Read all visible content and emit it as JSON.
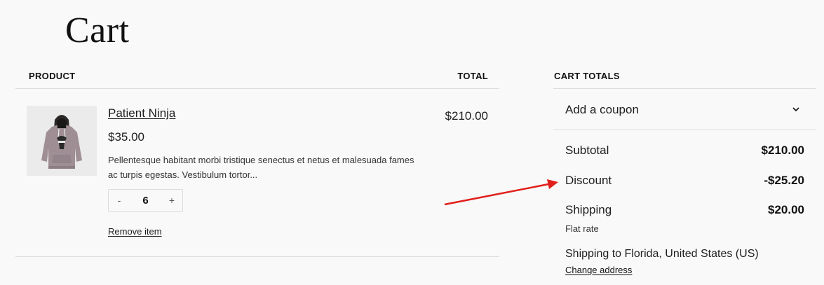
{
  "page_title": "Cart",
  "table": {
    "product_header": "PRODUCT",
    "total_header": "TOTAL"
  },
  "item": {
    "name": "Patient Ninja",
    "price": "$35.00",
    "description": "Pellentesque habitant morbi tristique senectus et netus et malesuada fames ac turpis egestas. Vestibulum tortor...",
    "quantity": "6",
    "minus_label": "-",
    "plus_label": "+",
    "remove_label": "Remove item",
    "line_total": "$210.00"
  },
  "totals": {
    "heading": "CART TOTALS",
    "coupon_label": "Add a coupon",
    "subtotal_label": "Subtotal",
    "subtotal_value": "$210.00",
    "discount_label": "Discount",
    "discount_value": "-$25.20",
    "shipping_label": "Shipping",
    "shipping_value": "$20.00",
    "shipping_method": "Flat rate",
    "shipping_destination": "Shipping to Florida, United States (US)",
    "change_address_label": "Change address"
  },
  "colors": {
    "background": "#f9f9f9",
    "annotation_arrow": "#e0201c",
    "hoodie": "#9f8f95"
  },
  "icons": {
    "coupon_toggle": "chevron-down-icon",
    "annotation": "red-arrow-annotation"
  }
}
